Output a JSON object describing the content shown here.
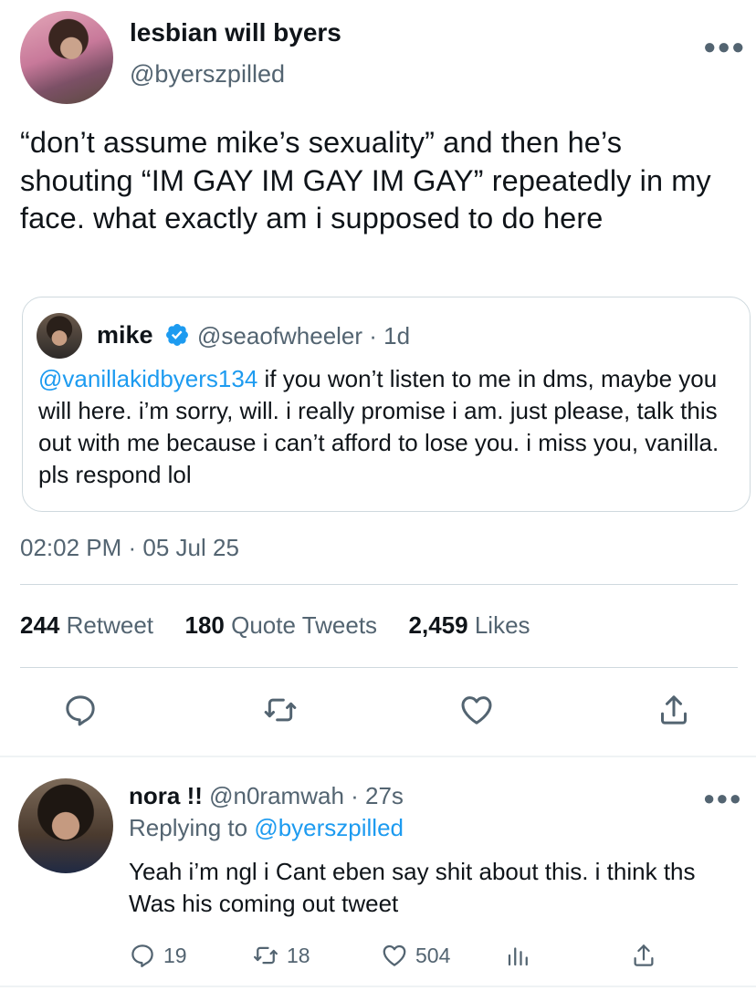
{
  "main_tweet": {
    "display_name": "lesbian will byers",
    "handle": "@byerszpilled",
    "text": "“don’t assume mike’s sexuality” and then he’s shouting “IM GAY IM GAY IM GAY” repeatedly in my face. what exactly am i supposed to do here",
    "more_icon": "more-horizontal-icon",
    "timestamp": "02:02 PM · 05 Jul 25",
    "stats": {
      "retweets_count": "244",
      "retweets_label": "Retweet",
      "quotes_count": "180",
      "quotes_label": "Quote Tweets",
      "likes_count": "2,459",
      "likes_label": "Likes"
    },
    "actions": [
      "reply-icon",
      "retweet-icon",
      "like-icon",
      "share-icon"
    ]
  },
  "quoted_tweet": {
    "display_name": "mike",
    "verified_icon": "verified-badge-icon",
    "meta": "@seaofwheeler · 1d",
    "mention": "@vanillakidbyers134",
    "text": " if you won’t listen to me in dms, maybe you will here. i’m sorry, will. i really promise i am. just please, talk this out with me because i can’t afford to lose you. i miss you, vanilla. pls respond lol"
  },
  "reply": {
    "display_name": "nora !!",
    "meta": " @n0ramwah · 27s",
    "replying_prefix": "Replying to ",
    "replying_handle": "@byerszpilled",
    "text": "Yeah i’m ngl i Cant eben say shit about this. i think ths Was his coming out tweet",
    "more_icon": "more-horizontal-icon",
    "actions": {
      "reply_count": "19",
      "retweet_count": "18",
      "like_count": "504"
    }
  },
  "colors": {
    "accent": "#1d9bf0",
    "secondary_text": "#536471",
    "primary_text": "#0f1419",
    "border": "#cfd9de"
  }
}
